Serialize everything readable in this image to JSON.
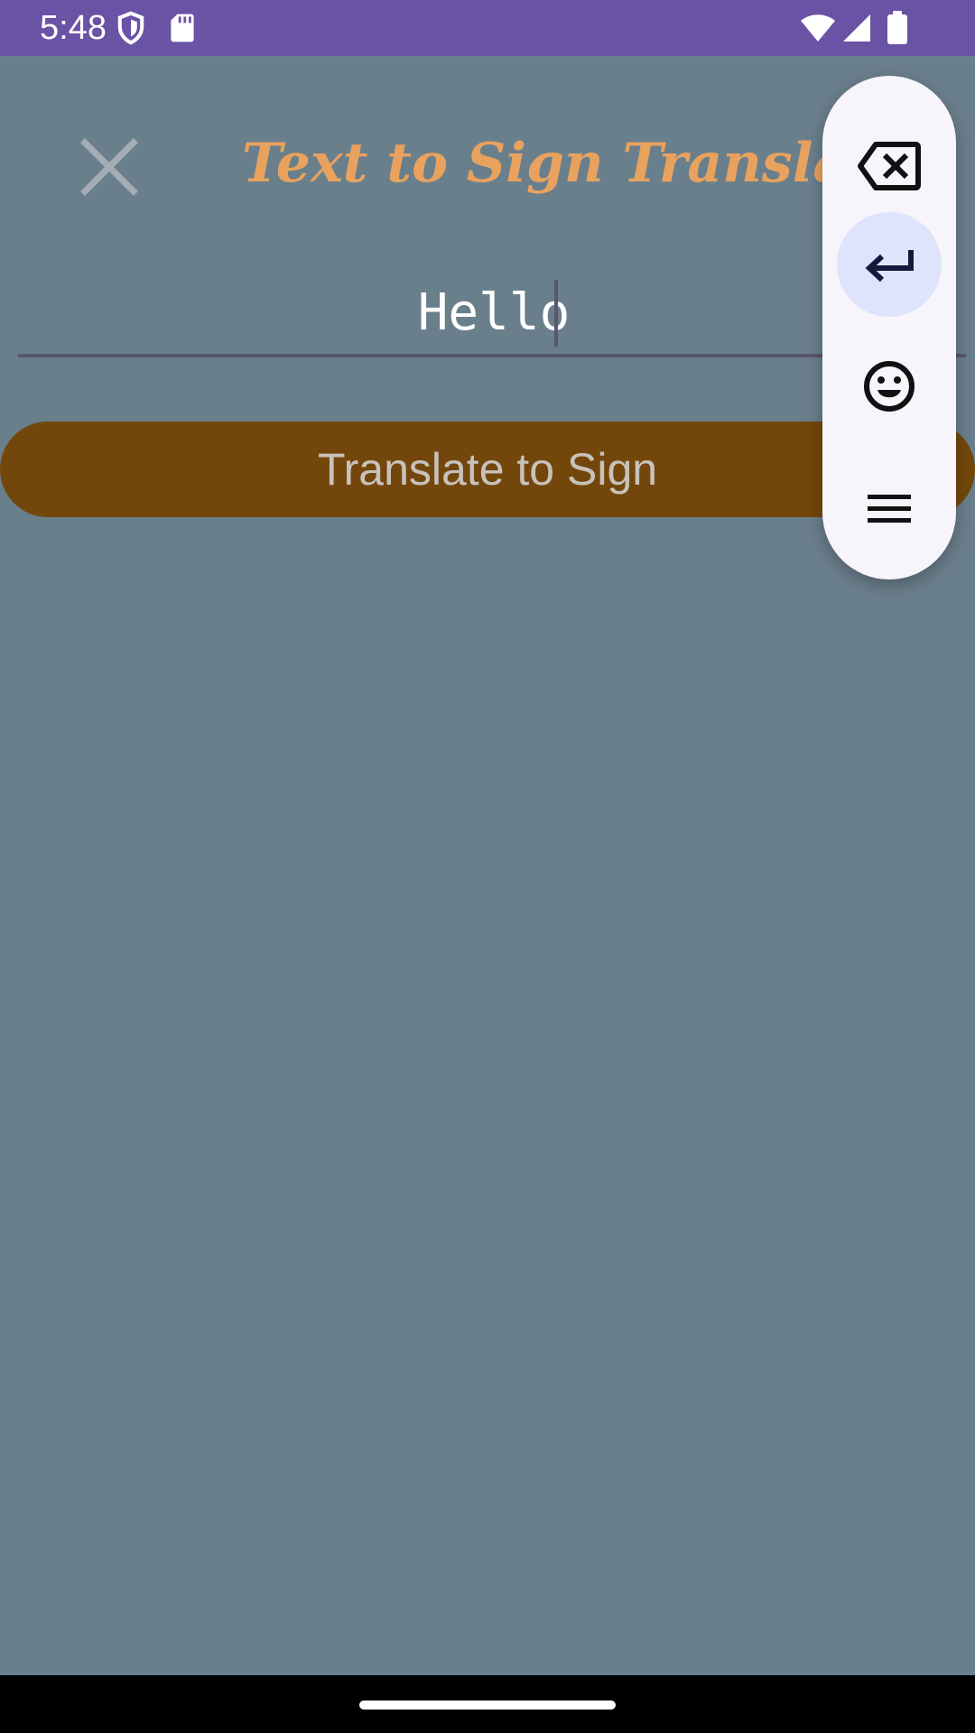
{
  "status_bar": {
    "time": "5:48",
    "icons": [
      "shield-icon",
      "sd-card-icon",
      "wifi-icon",
      "cell-signal-icon",
      "battery-icon"
    ],
    "background": "#6a52a4"
  },
  "header": {
    "title": "Text to Sign Translation",
    "close_icon": "close-icon",
    "title_color": "#e8a25e"
  },
  "input": {
    "value": "Hello"
  },
  "translate_button": {
    "label": "Translate to Sign",
    "background": "#73470b"
  },
  "keyboard_toolbar": {
    "buttons": [
      "backspace-icon",
      "enter-icon",
      "emoji-icon",
      "menu-icon"
    ]
  },
  "colors": {
    "page_background": "#6a7f8c",
    "toolbar_background": "#f7f5fb",
    "enter_highlight": "#dde4fb"
  }
}
